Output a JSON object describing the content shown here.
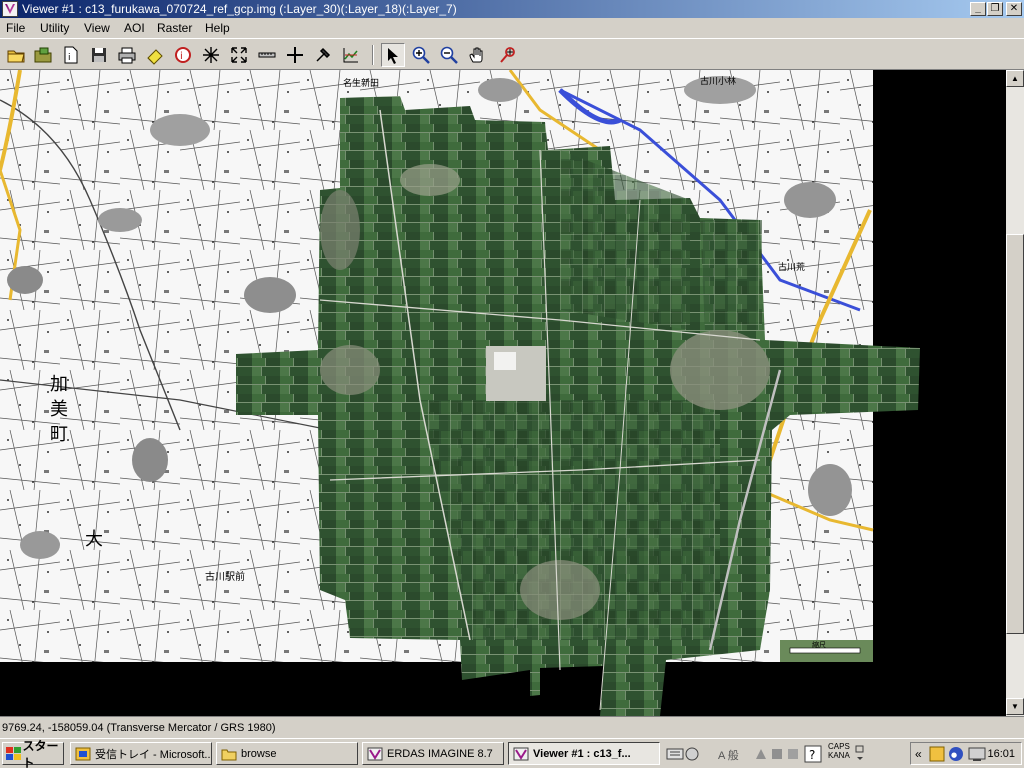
{
  "window": {
    "title": "Viewer #1 : c13_furukawa_070724_ref_gcp.img (:Layer_30)(:Layer_18)(:Layer_7)",
    "minimize_label": "_",
    "maximize_label": "❐",
    "close_label": "✕"
  },
  "menu": {
    "items": [
      {
        "label": "File"
      },
      {
        "label": "Utility"
      },
      {
        "label": "View"
      },
      {
        "label": "AOI"
      },
      {
        "label": "Raster"
      },
      {
        "label": "Help"
      }
    ]
  },
  "toolbar": {
    "tools": [
      "open-folder-icon",
      "open-layer-icon",
      "new-document-icon",
      "save-icon",
      "print-icon",
      "eraser-icon",
      "layer-info-icon",
      "reset-zoom-icon",
      "fit-icon",
      "measure-icon",
      "crosshair-icon",
      "roam-icon",
      "profile-icon",
      "select-arrow-icon",
      "zoom-in-icon",
      "zoom-out-icon",
      "pan-hand-icon",
      "inquire-icon"
    ]
  },
  "map": {
    "labels": {
      "ex_city": "大",
      "city_1": "加",
      "city_2": "美",
      "city_3": "町",
      "furukawa_ekimae": "古川駅前",
      "top_label": "名生新田",
      "right_label_1": "古川小林",
      "right_label_2": "古川荒",
      "scale_label": "縮尺"
    },
    "colors": {
      "topo_bg": "#f6f6f6",
      "road_yellow": "#e8b830",
      "river_blue": "#3a4fd8",
      "field_dark": "#2c4a2c",
      "field_mid": "#4a6e44"
    }
  },
  "status": {
    "text": "9769.24, -158059.04    (Transverse Mercator / GRS 1980)"
  },
  "taskbar": {
    "start_label": "スタート",
    "buttons": [
      {
        "label": "受信トレイ - Microsoft..."
      },
      {
        "label": "browse"
      },
      {
        "label": "ERDAS IMAGINE 8.7"
      },
      {
        "label": "Viewer #1 : c13_f..."
      }
    ],
    "tray": {
      "input_mode": "A 般",
      "caps": "CAPS",
      "kana": "KANA",
      "chevron": "«",
      "clock": "16:01"
    }
  }
}
